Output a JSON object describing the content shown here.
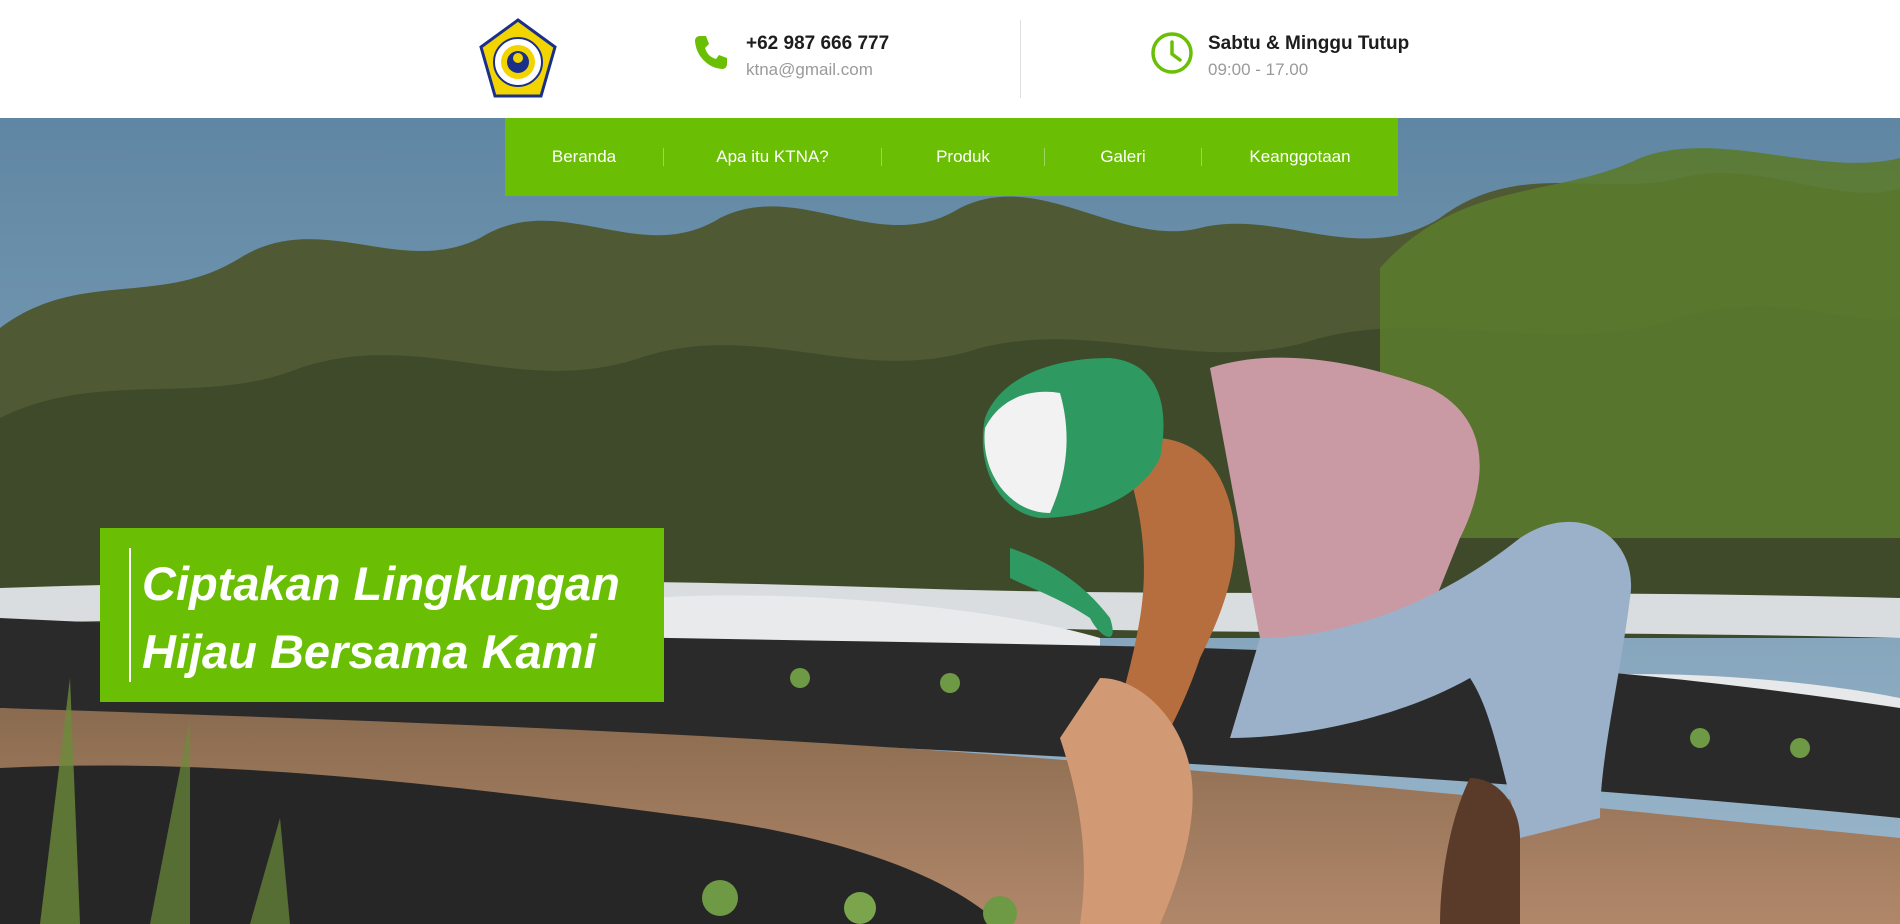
{
  "header": {
    "logo_name": "ktna-logo",
    "phone": {
      "icon": "phone-icon",
      "number": "+62 987 666 777",
      "email": "ktna@gmail.com"
    },
    "hours": {
      "icon": "clock-icon",
      "title": "Sabtu & Minggu Tutup",
      "time": "09:00 - 17.00"
    }
  },
  "nav": {
    "items": [
      "Beranda",
      "Apa itu KTNA?",
      "Produk",
      "Galeri",
      "Keanggotaan"
    ]
  },
  "hero": {
    "headline_line1": "Ciptakan Lingkungan",
    "headline_line2": "Hijau Bersama Kami",
    "image": "farmer-planting-seedlings-photo"
  },
  "colors": {
    "accent": "#6abf05",
    "text_dark": "#1d1d1d",
    "text_muted": "#9a9a9a"
  }
}
